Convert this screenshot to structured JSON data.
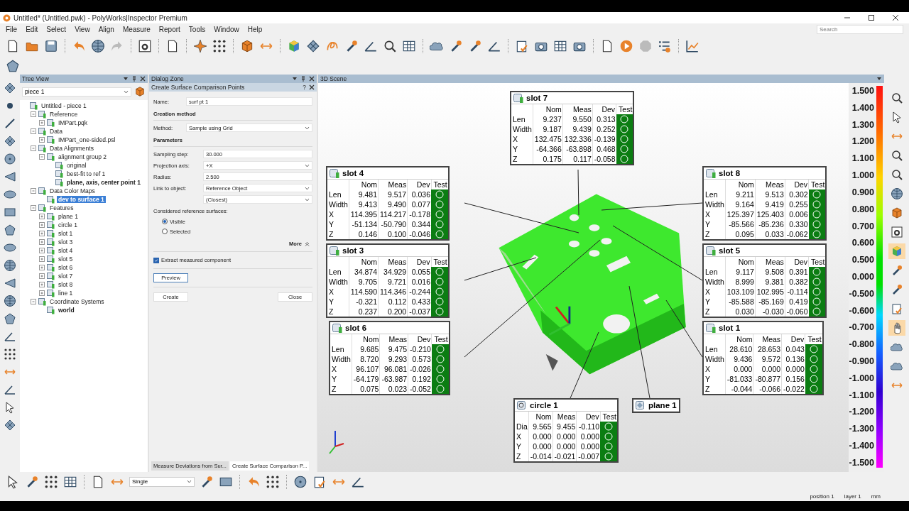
{
  "window": {
    "title": "Untitled* (Untitled.pwk) - PolyWorks|Inspector Premium",
    "search_placeholder": "Search"
  },
  "menu": [
    "File",
    "Edit",
    "Select",
    "View",
    "Align",
    "Measure",
    "Report",
    "Tools",
    "Window",
    "Help"
  ],
  "tree_view": {
    "title": "Tree View",
    "piece": "piece 1",
    "nodes": [
      {
        "label": "Untitled - piece 1",
        "selected": false,
        "children": [
          {
            "label": "Reference",
            "expanded": true,
            "selected": false,
            "children": [
              {
                "label": "IMPart.pqk",
                "expanded": false,
                "selected": false
              }
            ]
          },
          {
            "label": "Data",
            "expanded": true,
            "selected": false,
            "children": [
              {
                "label": "IMPart_one-sided.psl",
                "expanded": false,
                "selected": false
              }
            ]
          },
          {
            "label": "Data Alignments",
            "expanded": true,
            "selected": false,
            "children": [
              {
                "label": "alignment group 2",
                "expanded": true,
                "selected": false,
                "children": [
                  {
                    "label": "original",
                    "selected": false,
                    "active": false
                  },
                  {
                    "label": "best-fit to ref 1",
                    "selected": false,
                    "active": false
                  },
                  {
                    "label": "plane, axis, center point 1",
                    "selected": false,
                    "active": true
                  }
                ]
              }
            ]
          },
          {
            "label": "Data Color Maps",
            "expanded": true,
            "selected": false,
            "children": [
              {
                "label": "dev to surface 1",
                "selected": true
              }
            ]
          },
          {
            "label": "Features",
            "expanded": true,
            "selected": false,
            "children": [
              {
                "label": "plane 1",
                "expanded": false,
                "selected": false
              },
              {
                "label": "circle 1",
                "expanded": false,
                "selected": false
              },
              {
                "label": "slot 1",
                "expanded": false,
                "selected": false
              },
              {
                "label": "slot 3",
                "expanded": false,
                "selected": false
              },
              {
                "label": "slot 4",
                "expanded": false,
                "selected": false
              },
              {
                "label": "slot 5",
                "expanded": false,
                "selected": false
              },
              {
                "label": "slot 6",
                "expanded": false,
                "selected": false
              },
              {
                "label": "slot 7",
                "expanded": false,
                "selected": false
              },
              {
                "label": "slot 8",
                "expanded": false,
                "selected": false
              },
              {
                "label": "line 1",
                "expanded": false,
                "selected": false
              }
            ]
          },
          {
            "label": "Coordinate Systems",
            "expanded": true,
            "selected": false,
            "children": [
              {
                "label": "world",
                "selected": false,
                "active": true
              }
            ]
          }
        ]
      }
    ]
  },
  "dialog": {
    "zone_title": "Dialog Zone",
    "title": "Create Surface Comparison Points",
    "help": "?",
    "name": {
      "label": "Name:",
      "value": "surf pt 1"
    },
    "creation_heading": "Creation method",
    "method": {
      "label": "Method:",
      "value": "Sample using Grid"
    },
    "parameters_heading": "Parameters",
    "fields": [
      {
        "label": "Sampling step:",
        "value": "30.000",
        "kind": "input"
      },
      {
        "label": "Projection axis:",
        "value": "+X",
        "kind": "select"
      },
      {
        "label": "Radius:",
        "value": "2.500",
        "kind": "input"
      },
      {
        "label": "Link to object:",
        "value": "Reference Object",
        "kind": "select"
      },
      {
        "value": "(Closest)",
        "kind": "select"
      }
    ],
    "surfaces_label": "Considered reference surfaces:",
    "surfaces": [
      {
        "label": "Visible",
        "selected": true
      },
      {
        "label": "Selected",
        "selected": false
      }
    ],
    "more": "More",
    "extract": {
      "label": "Extract measured component",
      "checked": true
    },
    "preview": "Preview",
    "create": "Create",
    "close": "Close",
    "tabs": [
      {
        "label": "Measure Deviations from Sur...",
        "selected": false
      },
      {
        "label": "Create Surface Comparison P...",
        "selected": true
      }
    ]
  },
  "scene": {
    "title": "3D Scene",
    "callouts": [
      {
        "title": "slot 7",
        "kind": "slot",
        "columns": [
          "Nom",
          "Meas",
          "Dev",
          "Test"
        ],
        "rows": [
          {
            "label": "Len",
            "nom": "9.237",
            "meas": "9.550",
            "dev": "0.313",
            "passed": true
          },
          {
            "label": "Width",
            "nom": "9.187",
            "meas": "9.439",
            "dev": "0.252",
            "passed": true
          },
          {
            "label": "X",
            "nom": "132.475",
            "meas": "132.336",
            "dev": "-0.139",
            "passed": true
          },
          {
            "label": "Y",
            "nom": "-64.366",
            "meas": "-63.898",
            "dev": "0.468",
            "passed": true
          },
          {
            "label": "Z",
            "nom": "0.175",
            "meas": "0.117",
            "dev": "-0.058",
            "passed": true
          }
        ]
      },
      {
        "title": "slot 4",
        "kind": "slot",
        "columns": [
          "Nom",
          "Meas",
          "Dev",
          "Test"
        ],
        "rows": [
          {
            "label": "Len",
            "nom": "9.481",
            "meas": "9.517",
            "dev": "0.036",
            "passed": true
          },
          {
            "label": "Width",
            "nom": "9.413",
            "meas": "9.490",
            "dev": "0.077",
            "passed": true
          },
          {
            "label": "X",
            "nom": "114.395",
            "meas": "114.217",
            "dev": "-0.178",
            "passed": true
          },
          {
            "label": "Y",
            "nom": "-51.134",
            "meas": "-50.790",
            "dev": "0.344",
            "passed": true
          },
          {
            "label": "Z",
            "nom": "0.146",
            "meas": "0.100",
            "dev": "-0.046",
            "passed": true
          }
        ]
      },
      {
        "title": "slot 8",
        "kind": "slot",
        "columns": [
          "Nom",
          "Meas",
          "Dev",
          "Test"
        ],
        "rows": [
          {
            "label": "Len",
            "nom": "9.211",
            "meas": "9.513",
            "dev": "0.302",
            "passed": true
          },
          {
            "label": "Width",
            "nom": "9.164",
            "meas": "9.419",
            "dev": "0.255",
            "passed": true
          },
          {
            "label": "X",
            "nom": "125.397",
            "meas": "125.403",
            "dev": "0.006",
            "passed": true
          },
          {
            "label": "Y",
            "nom": "-85.566",
            "meas": "-85.236",
            "dev": "0.330",
            "passed": true
          },
          {
            "label": "Z",
            "nom": "0.095",
            "meas": "0.033",
            "dev": "-0.062",
            "passed": true
          }
        ]
      },
      {
        "title": "slot 3",
        "kind": "slot",
        "columns": [
          "Nom",
          "Meas",
          "Dev",
          "Test"
        ],
        "rows": [
          {
            "label": "Len",
            "nom": "34.874",
            "meas": "34.929",
            "dev": "0.055",
            "passed": true
          },
          {
            "label": "Width",
            "nom": "9.705",
            "meas": "9.721",
            "dev": "0.016",
            "passed": true
          },
          {
            "label": "X",
            "nom": "114.590",
            "meas": "114.346",
            "dev": "-0.244",
            "passed": true
          },
          {
            "label": "Y",
            "nom": "-0.321",
            "meas": "0.112",
            "dev": "0.433",
            "passed": true
          },
          {
            "label": "Z",
            "nom": "0.237",
            "meas": "0.200",
            "dev": "-0.037",
            "passed": true
          }
        ]
      },
      {
        "title": "slot 5",
        "kind": "slot",
        "columns": [
          "Nom",
          "Meas",
          "Dev",
          "Test"
        ],
        "rows": [
          {
            "label": "Len",
            "nom": "9.117",
            "meas": "9.508",
            "dev": "0.391",
            "passed": true
          },
          {
            "label": "Width",
            "nom": "8.999",
            "meas": "9.381",
            "dev": "0.382",
            "passed": true
          },
          {
            "label": "X",
            "nom": "103.109",
            "meas": "102.995",
            "dev": "-0.114",
            "passed": true
          },
          {
            "label": "Y",
            "nom": "-85.588",
            "meas": "-85.169",
            "dev": "0.419",
            "passed": true
          },
          {
            "label": "Z",
            "nom": "0.030",
            "meas": "-0.030",
            "dev": "-0.060",
            "passed": true
          }
        ]
      },
      {
        "title": "slot 6",
        "kind": "slot",
        "columns": [
          "Nom",
          "Meas",
          "Dev",
          "Test"
        ],
        "rows": [
          {
            "label": "Len",
            "nom": "9.685",
            "meas": "9.475",
            "dev": "-0.210",
            "passed": true
          },
          {
            "label": "Width",
            "nom": "8.720",
            "meas": "9.293",
            "dev": "0.573",
            "passed": true
          },
          {
            "label": "X",
            "nom": "96.107",
            "meas": "96.081",
            "dev": "-0.026",
            "passed": true
          },
          {
            "label": "Y",
            "nom": "-64.179",
            "meas": "-63.987",
            "dev": "0.192",
            "passed": true
          },
          {
            "label": "Z",
            "nom": "0.075",
            "meas": "0.023",
            "dev": "-0.052",
            "passed": true
          }
        ]
      },
      {
        "title": "slot 1",
        "kind": "slot",
        "columns": [
          "Nom",
          "Meas",
          "Dev",
          "Test"
        ],
        "rows": [
          {
            "label": "Len",
            "nom": "28.610",
            "meas": "28.653",
            "dev": "0.043",
            "passed": true
          },
          {
            "label": "Width",
            "nom": "9.436",
            "meas": "9.572",
            "dev": "0.136",
            "passed": true
          },
          {
            "label": "X",
            "nom": "0.000",
            "meas": "0.000",
            "dev": "0.000",
            "passed": true
          },
          {
            "label": "Y",
            "nom": "-81.033",
            "meas": "-80.877",
            "dev": "0.156",
            "passed": true
          },
          {
            "label": "Z",
            "nom": "-0.044",
            "meas": "-0.066",
            "dev": "-0.022",
            "passed": true
          }
        ]
      },
      {
        "title": "circle 1",
        "kind": "circle",
        "columns": [
          "Nom",
          "Meas",
          "Dev",
          "Test"
        ],
        "rows": [
          {
            "label": "Dia",
            "nom": "9.565",
            "meas": "9.455",
            "dev": "-0.110",
            "passed": true
          },
          {
            "label": "X",
            "nom": "0.000",
            "meas": "0.000",
            "dev": "0.000",
            "passed": true
          },
          {
            "label": "Y",
            "nom": "0.000",
            "meas": "0.000",
            "dev": "0.000",
            "passed": true
          },
          {
            "label": "Z",
            "nom": "-0.014",
            "meas": "-0.021",
            "dev": "-0.007",
            "passed": true
          }
        ]
      },
      {
        "title": "plane 1",
        "kind": "plane"
      }
    ],
    "color_scale": [
      "1.500",
      "1.400",
      "1.300",
      "1.200",
      "1.100",
      "1.000",
      "0.900",
      "0.800",
      "0.700",
      "0.600",
      "0.500",
      "0.000",
      "-0.500",
      "-0.600",
      "-0.700",
      "-0.800",
      "-0.900",
      "-1.000",
      "-1.100",
      "-1.200",
      "-1.300",
      "-1.400",
      "-1.500"
    ]
  },
  "right_toolbar": [
    {
      "selected": false
    },
    {
      "selected": false
    },
    {
      "selected": false
    },
    {
      "selected": false
    },
    {
      "selected": false
    },
    {
      "selected": false
    },
    {
      "selected": false
    },
    {
      "selected": false
    },
    {
      "selected": true
    },
    {
      "selected": false
    },
    {
      "selected": false
    },
    {
      "selected": false
    },
    {
      "selected": true
    },
    {
      "selected": false
    },
    {
      "selected": false
    },
    {
      "selected": false
    }
  ],
  "bottom_toolbar": {
    "mode": "Single"
  },
  "status_bar": [
    "position 1",
    "layer 1",
    "mm"
  ]
}
